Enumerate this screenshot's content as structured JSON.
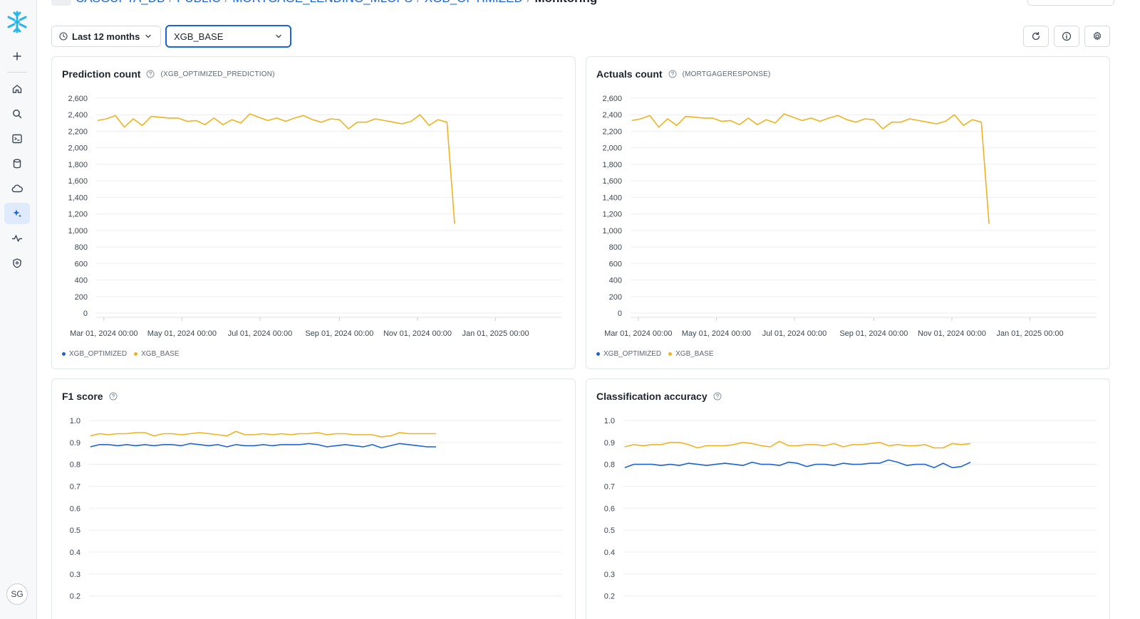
{
  "breadcrumb": {
    "items": [
      "CASGUPTA_DB",
      "PUBLIC",
      "MORTGAGE_LENDING_MLOPS",
      "XGB_OPTIMIZED"
    ],
    "current": "Monitoring",
    "separator": "/"
  },
  "toolbar": {
    "time_range_label": "Last 12 months",
    "model_select_value": "XGB_BASE"
  },
  "sidebar": {
    "items": [
      "add-icon",
      "home-icon",
      "search-icon",
      "terminal-icon",
      "database-icon",
      "cloud-icon",
      "ai-sparkle-icon",
      "activity-icon",
      "shield-icon"
    ],
    "active": "ai-sparkle-icon",
    "avatar_initials": "SG"
  },
  "colors": {
    "accent": "#1a64d6",
    "series_optimized": "#1a64d6",
    "series_base": "#f0b21f"
  },
  "cards": {
    "prediction": {
      "title": "Prediction count",
      "subtitle": "(XGB_OPTIMIZED_PREDICTION)"
    },
    "actuals": {
      "title": "Actuals count",
      "subtitle": "(MORTGAGERESPONSE)"
    },
    "f1": {
      "title": "F1 score"
    },
    "accuracy": {
      "title": "Classification accuracy"
    }
  },
  "legend": {
    "optimized": "XGB_OPTIMIZED",
    "base": "XGB_BASE"
  },
  "chart_data": [
    {
      "id": "prediction",
      "type": "line",
      "title": "Prediction count",
      "ylim": [
        0,
        2600
      ],
      "yticks": [
        0,
        200,
        400,
        600,
        800,
        1000,
        1200,
        1400,
        1600,
        1800,
        2000,
        2200,
        2400,
        2600
      ],
      "ytick_labels": [
        "0",
        "200",
        "400",
        "600",
        "800",
        "1,000",
        "1,200",
        "1,400",
        "1,600",
        "1,800",
        "2,000",
        "2,200",
        "2,400",
        "2,600"
      ],
      "xticks": [
        "2024-03-01",
        "2024-05-01",
        "2024-07-01",
        "2024-09-01",
        "2024-11-01",
        "2025-01-01"
      ],
      "xtick_labels": [
        "Mar 01, 2024 00:00",
        "May 01, 2024 00:00",
        "Jul 01, 2024 00:00",
        "Sep 01, 2024 00:00",
        "Nov 01, 2024 00:00",
        "Jan 01, 2025 00:00"
      ],
      "xlim": [
        "2024-02-24",
        "2025-02-22"
      ],
      "grid": true,
      "series": [
        {
          "name": "XGB_BASE",
          "color": "#f0b21f",
          "x": [
            "2024-02-25",
            "2024-03-03",
            "2024-03-10",
            "2024-03-17",
            "2024-03-24",
            "2024-03-31",
            "2024-04-07",
            "2024-04-14",
            "2024-04-21",
            "2024-04-28",
            "2024-05-05",
            "2024-05-12",
            "2024-05-19",
            "2024-05-26",
            "2024-06-02",
            "2024-06-09",
            "2024-06-16",
            "2024-06-23",
            "2024-06-30",
            "2024-07-07",
            "2024-07-14",
            "2024-07-21",
            "2024-07-28",
            "2024-08-04",
            "2024-08-11",
            "2024-08-18",
            "2024-08-25",
            "2024-09-01",
            "2024-09-08",
            "2024-09-15",
            "2024-09-22",
            "2024-09-29",
            "2024-10-06",
            "2024-10-13",
            "2024-10-20",
            "2024-10-27",
            "2024-11-03",
            "2024-11-10",
            "2024-11-17"
          ],
          "values": [
            2330,
            2350,
            2390,
            2250,
            2350,
            2270,
            2380,
            2370,
            2360,
            2360,
            2320,
            2330,
            2280,
            2360,
            2280,
            2340,
            2300,
            2410,
            2370,
            2330,
            2360,
            2320,
            2360,
            2390,
            2340,
            2310,
            2350,
            2340,
            2230,
            2310,
            2310,
            2350,
            2330,
            2310,
            2290,
            2320,
            2400,
            2270,
            2340
          ]
        },
        {
          "name": "XGB_BASE_drop",
          "color": "#f0b21f",
          "x": [
            "2024-11-17",
            "2024-11-24",
            "2024-11-30"
          ],
          "values": [
            2340,
            2310,
            1080
          ]
        }
      ]
    },
    {
      "id": "actuals",
      "type": "line",
      "title": "Actuals count",
      "ylim": [
        0,
        2600
      ],
      "yticks": [
        0,
        200,
        400,
        600,
        800,
        1000,
        1200,
        1400,
        1600,
        1800,
        2000,
        2200,
        2400,
        2600
      ],
      "ytick_labels": [
        "0",
        "200",
        "400",
        "600",
        "800",
        "1,000",
        "1,200",
        "1,400",
        "1,600",
        "1,800",
        "2,000",
        "2,200",
        "2,400",
        "2,600"
      ],
      "xticks": [
        "2024-03-01",
        "2024-05-01",
        "2024-07-01",
        "2024-09-01",
        "2024-11-01",
        "2025-01-01"
      ],
      "xtick_labels": [
        "Mar 01, 2024 00:00",
        "May 01, 2024 00:00",
        "Jul 01, 2024 00:00",
        "Sep 01, 2024 00:00",
        "Nov 01, 2024 00:00",
        "Jan 01, 2025 00:00"
      ],
      "xlim": [
        "2024-02-24",
        "2025-02-22"
      ],
      "grid": true,
      "series": [
        {
          "name": "XGB_BASE",
          "color": "#f0b21f",
          "x": [
            "2024-02-25",
            "2024-03-03",
            "2024-03-10",
            "2024-03-17",
            "2024-03-24",
            "2024-03-31",
            "2024-04-07",
            "2024-04-14",
            "2024-04-21",
            "2024-04-28",
            "2024-05-05",
            "2024-05-12",
            "2024-05-19",
            "2024-05-26",
            "2024-06-02",
            "2024-06-09",
            "2024-06-16",
            "2024-06-23",
            "2024-06-30",
            "2024-07-07",
            "2024-07-14",
            "2024-07-21",
            "2024-07-28",
            "2024-08-04",
            "2024-08-11",
            "2024-08-18",
            "2024-08-25",
            "2024-09-01",
            "2024-09-08",
            "2024-09-15",
            "2024-09-22",
            "2024-09-29",
            "2024-10-06",
            "2024-10-13",
            "2024-10-20",
            "2024-10-27",
            "2024-11-03",
            "2024-11-10",
            "2024-11-17",
            "2024-11-24",
            "2024-11-30"
          ],
          "values": [
            2330,
            2350,
            2390,
            2250,
            2350,
            2270,
            2380,
            2370,
            2360,
            2360,
            2320,
            2330,
            2280,
            2360,
            2280,
            2340,
            2300,
            2410,
            2370,
            2330,
            2360,
            2320,
            2360,
            2390,
            2340,
            2310,
            2350,
            2340,
            2230,
            2310,
            2310,
            2350,
            2330,
            2310,
            2290,
            2320,
            2400,
            2270,
            2340,
            2310,
            1080
          ]
        }
      ]
    },
    {
      "id": "f1",
      "type": "line",
      "title": "F1 score",
      "ylim": [
        0.15,
        1.0
      ],
      "yticks": [
        0.2,
        0.3,
        0.4,
        0.5,
        0.6,
        0.7,
        0.8,
        0.9,
        1.0
      ],
      "ytick_labels": [
        "0.2",
        "0.3",
        "0.4",
        "0.5",
        "0.6",
        "0.7",
        "0.8",
        "0.9",
        "1.0"
      ],
      "xlim": [
        "2024-02-24",
        "2025-02-22"
      ],
      "grid": true,
      "series": [
        {
          "name": "XGB_BASE",
          "color": "#f0b21f",
          "x": [
            "2024-02-25",
            "2024-03-03",
            "2024-03-10",
            "2024-03-17",
            "2024-03-24",
            "2024-03-31",
            "2024-04-07",
            "2024-04-14",
            "2024-04-21",
            "2024-04-28",
            "2024-05-05",
            "2024-05-12",
            "2024-05-19",
            "2024-05-26",
            "2024-06-02",
            "2024-06-09",
            "2024-06-16",
            "2024-06-23",
            "2024-06-30",
            "2024-07-07",
            "2024-07-14",
            "2024-07-21",
            "2024-07-28",
            "2024-08-04",
            "2024-08-11",
            "2024-08-18",
            "2024-08-25",
            "2024-09-01",
            "2024-09-08",
            "2024-09-15",
            "2024-09-22",
            "2024-09-29",
            "2024-10-06",
            "2024-10-13",
            "2024-10-20",
            "2024-10-27",
            "2024-11-03",
            "2024-11-10",
            "2024-11-17"
          ],
          "values": [
            0.93,
            0.94,
            0.935,
            0.94,
            0.94,
            0.945,
            0.945,
            0.93,
            0.94,
            0.94,
            0.935,
            0.94,
            0.945,
            0.94,
            0.935,
            0.93,
            0.95,
            0.935,
            0.935,
            0.94,
            0.935,
            0.94,
            0.935,
            0.94,
            0.94,
            0.945,
            0.935,
            0.94,
            0.94,
            0.935,
            0.935,
            0.935,
            0.925,
            0.93,
            0.945,
            0.94,
            0.94,
            0.94,
            0.94
          ]
        },
        {
          "name": "XGB_OPTIMIZED",
          "color": "#1a64d6",
          "x": [
            "2024-02-25",
            "2024-03-03",
            "2024-03-10",
            "2024-03-17",
            "2024-03-24",
            "2024-03-31",
            "2024-04-07",
            "2024-04-14",
            "2024-04-21",
            "2024-04-28",
            "2024-05-05",
            "2024-05-12",
            "2024-05-19",
            "2024-05-26",
            "2024-06-02",
            "2024-06-09",
            "2024-06-16",
            "2024-06-23",
            "2024-06-30",
            "2024-07-07",
            "2024-07-14",
            "2024-07-21",
            "2024-07-28",
            "2024-08-04",
            "2024-08-11",
            "2024-08-18",
            "2024-08-25",
            "2024-09-01",
            "2024-09-08",
            "2024-09-15",
            "2024-09-22",
            "2024-09-29",
            "2024-10-06",
            "2024-10-13",
            "2024-10-20",
            "2024-10-27",
            "2024-11-03",
            "2024-11-10",
            "2024-11-17"
          ],
          "values": [
            0.88,
            0.89,
            0.89,
            0.885,
            0.89,
            0.885,
            0.89,
            0.885,
            0.89,
            0.89,
            0.885,
            0.895,
            0.89,
            0.885,
            0.89,
            0.88,
            0.89,
            0.885,
            0.885,
            0.89,
            0.885,
            0.89,
            0.89,
            0.89,
            0.895,
            0.89,
            0.88,
            0.885,
            0.89,
            0.885,
            0.88,
            0.89,
            0.875,
            0.885,
            0.895,
            0.89,
            0.885,
            0.88,
            0.88
          ]
        }
      ]
    },
    {
      "id": "accuracy",
      "type": "line",
      "title": "Classification accuracy",
      "ylim": [
        0.15,
        1.0
      ],
      "yticks": [
        0.2,
        0.3,
        0.4,
        0.5,
        0.6,
        0.7,
        0.8,
        0.9,
        1.0
      ],
      "ytick_labels": [
        "0.2",
        "0.3",
        "0.4",
        "0.5",
        "0.6",
        "0.7",
        "0.8",
        "0.9",
        "1.0"
      ],
      "xlim": [
        "2024-02-24",
        "2025-02-22"
      ],
      "grid": true,
      "series": [
        {
          "name": "XGB_BASE",
          "color": "#f0b21f",
          "x": [
            "2024-02-25",
            "2024-03-03",
            "2024-03-10",
            "2024-03-17",
            "2024-03-24",
            "2024-03-31",
            "2024-04-07",
            "2024-04-14",
            "2024-04-21",
            "2024-04-28",
            "2024-05-05",
            "2024-05-12",
            "2024-05-19",
            "2024-05-26",
            "2024-06-02",
            "2024-06-09",
            "2024-06-16",
            "2024-06-23",
            "2024-06-30",
            "2024-07-07",
            "2024-07-14",
            "2024-07-21",
            "2024-07-28",
            "2024-08-04",
            "2024-08-11",
            "2024-08-18",
            "2024-08-25",
            "2024-09-01",
            "2024-09-08",
            "2024-09-15",
            "2024-09-22",
            "2024-09-29",
            "2024-10-06",
            "2024-10-13",
            "2024-10-20",
            "2024-10-27",
            "2024-11-03",
            "2024-11-10",
            "2024-11-17"
          ],
          "values": [
            0.88,
            0.89,
            0.885,
            0.89,
            0.89,
            0.9,
            0.9,
            0.89,
            0.875,
            0.885,
            0.885,
            0.885,
            0.89,
            0.9,
            0.895,
            0.885,
            0.88,
            0.905,
            0.885,
            0.885,
            0.89,
            0.89,
            0.885,
            0.895,
            0.88,
            0.89,
            0.89,
            0.895,
            0.9,
            0.885,
            0.89,
            0.885,
            0.885,
            0.89,
            0.875,
            0.875,
            0.895,
            0.89,
            0.895
          ]
        },
        {
          "name": "XGB_OPTIMIZED",
          "color": "#1a64d6",
          "x": [
            "2024-02-25",
            "2024-03-03",
            "2024-03-10",
            "2024-03-17",
            "2024-03-24",
            "2024-03-31",
            "2024-04-07",
            "2024-04-14",
            "2024-04-21",
            "2024-04-28",
            "2024-05-05",
            "2024-05-12",
            "2024-05-19",
            "2024-05-26",
            "2024-06-02",
            "2024-06-09",
            "2024-06-16",
            "2024-06-23",
            "2024-06-30",
            "2024-07-07",
            "2024-07-14",
            "2024-07-21",
            "2024-07-28",
            "2024-08-04",
            "2024-08-11",
            "2024-08-18",
            "2024-08-25",
            "2024-09-01",
            "2024-09-08",
            "2024-09-15",
            "2024-09-22",
            "2024-09-29",
            "2024-10-06",
            "2024-10-13",
            "2024-10-20",
            "2024-10-27",
            "2024-11-03",
            "2024-11-10",
            "2024-11-17"
          ],
          "values": [
            0.785,
            0.8,
            0.8,
            0.8,
            0.795,
            0.8,
            0.795,
            0.805,
            0.8,
            0.795,
            0.8,
            0.805,
            0.8,
            0.795,
            0.81,
            0.8,
            0.8,
            0.795,
            0.81,
            0.805,
            0.79,
            0.8,
            0.8,
            0.795,
            0.805,
            0.8,
            0.8,
            0.805,
            0.805,
            0.82,
            0.81,
            0.795,
            0.8,
            0.8,
            0.785,
            0.805,
            0.785,
            0.79,
            0.81
          ]
        }
      ]
    }
  ]
}
